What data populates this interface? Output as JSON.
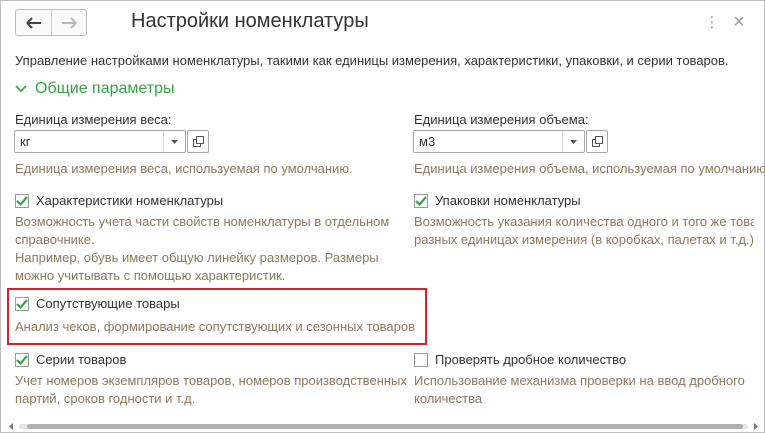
{
  "window": {
    "title": "Настройки номенклатуры",
    "more_symbol": "⋮",
    "close_symbol": "×"
  },
  "description": "Управление настройками номенклатуры, такими как единицы измерения, характеристики, упаковки, и серии товаров.",
  "group": {
    "title": "Общие параметры",
    "expanded": true
  },
  "weight_unit": {
    "label": "Единица измерения веса:",
    "value": "кг",
    "hint": "Единица измерения веса, используемая по умолчанию."
  },
  "volume_unit": {
    "label": "Единица измерения объема:",
    "value": "м3",
    "hint": "Единица измерения объема, используемая по умолчанию."
  },
  "characteristics": {
    "label": "Характеристики номенклатуры",
    "checked": true,
    "hint_lines": [
      "Возможность учета части свойств номенклатуры в отдельном",
      "справочнике.",
      "Например, обувь имеет общую линейку размеров. Размеры",
      "можно учитывать с помощью характеристик."
    ]
  },
  "packages": {
    "label": "Упаковки номенклатуры",
    "checked": true,
    "hint_lines": [
      "Возможность указания количества одного и того же товара",
      "разных единицах измерения (в коробках, палетах и т.д.)."
    ]
  },
  "related_goods": {
    "label": "Сопутствующие товары",
    "checked": true,
    "hint": "Анализ чеков, формирование сопутствующих и сезонных товаров"
  },
  "series": {
    "label": "Серии товаров",
    "checked": true,
    "hint_lines": [
      "Учет номеров экземпляров товаров, номеров производственных",
      "партий, сроков годности и т.д."
    ]
  },
  "fractional": {
    "label": "Проверять дробное количество",
    "checked": false,
    "hint_lines": [
      "Использование механизма проверки на ввод дробного",
      "количества"
    ]
  },
  "colors": {
    "accent_green": "#3aa34a",
    "hint_text": "#8c7a5e",
    "highlight_red": "#d2232a"
  },
  "icons": {
    "back": "arrow-left-icon",
    "forward": "arrow-right-icon",
    "more": "vertical-dots-icon",
    "close": "close-icon",
    "group_toggle": "chevron-down-icon",
    "dropdown": "triangle-down-icon",
    "open": "open-form-icon",
    "check": "checkmark-icon"
  }
}
